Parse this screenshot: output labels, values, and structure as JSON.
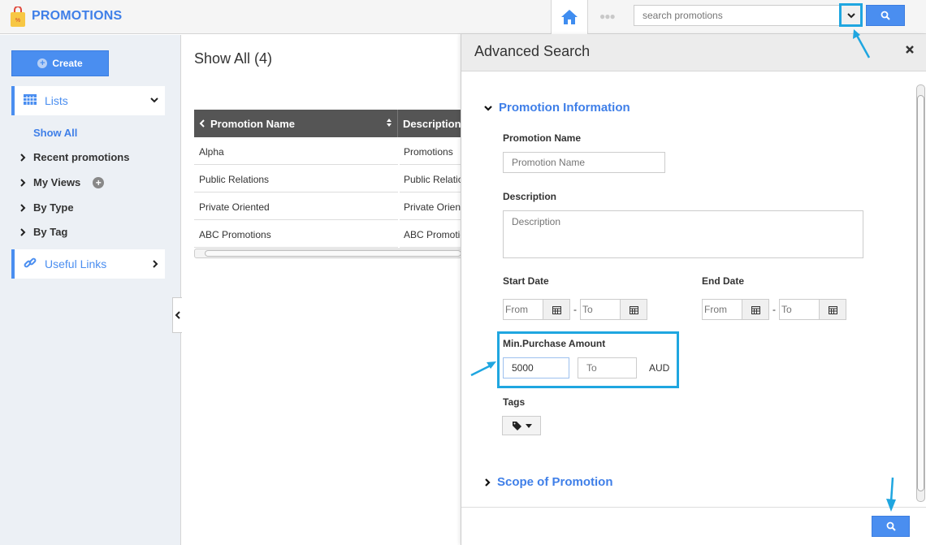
{
  "app": {
    "title": "PROMOTIONS",
    "logo_icon": "shopping-bag-icon"
  },
  "topbar": {
    "home_icon": "home-icon",
    "more_icon": "ellipsis-icon",
    "search_placeholder": "search promotions",
    "search_dropdown_icon": "chevron-down-icon",
    "search_button_icon": "search-icon"
  },
  "sidebar": {
    "create_label": "Create",
    "lists_label": "Lists",
    "items": [
      {
        "label": "Show All",
        "active": true
      },
      {
        "label": "Recent promotions"
      },
      {
        "label": "My Views"
      },
      {
        "label": "By Type"
      },
      {
        "label": "By Tag"
      }
    ],
    "useful_links_label": "Useful Links"
  },
  "main": {
    "title": "Show All (4)",
    "table": {
      "columns": [
        "Promotion Name",
        "Description"
      ],
      "rows": [
        [
          "Alpha",
          "Promotions"
        ],
        [
          "Public Relations",
          "Public Relations"
        ],
        [
          "Private Oriented",
          "Private Oriented"
        ],
        [
          "ABC Promotions",
          "ABC Promotions"
        ]
      ]
    }
  },
  "advanced_search": {
    "title": "Advanced Search",
    "section_info": "Promotion Information",
    "promotion_name_label": "Promotion Name",
    "promotion_name_placeholder": "Promotion Name",
    "description_label": "Description",
    "description_placeholder": "Description",
    "start_date_label": "Start Date",
    "end_date_label": "End Date",
    "from_placeholder": "From",
    "to_placeholder": "To",
    "date_separator": "-",
    "min_purchase_label": "Min.Purchase Amount",
    "min_purchase_from_value": "5000",
    "min_purchase_to_placeholder": "To",
    "currency": "AUD",
    "tags_label": "Tags",
    "section_scope": "Scope of Promotion"
  },
  "colors": {
    "accent": "#4a8ef0",
    "highlight": "#1fa6e0",
    "link": "#3f7fe8"
  }
}
